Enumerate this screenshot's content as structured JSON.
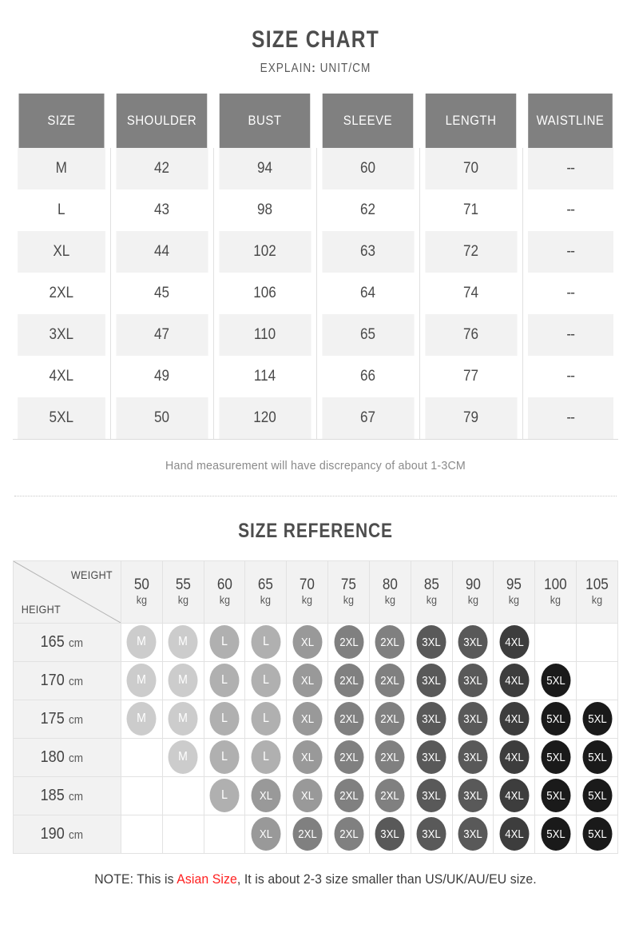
{
  "header": {
    "title": "SIZE CHART",
    "explain_label": "EXPLAIN",
    "explain_colon": ":",
    "explain_value": "UNIT/CM"
  },
  "size_chart": {
    "columns": [
      "SIZE",
      "SHOULDER",
      "BUST",
      "SLEEVE",
      "LENGTH",
      "WAISTLINE"
    ],
    "rows": [
      {
        "size": "M",
        "shoulder": "42",
        "bust": "94",
        "sleeve": "60",
        "length": "70",
        "waistline": "--"
      },
      {
        "size": "L",
        "shoulder": "43",
        "bust": "98",
        "sleeve": "62",
        "length": "71",
        "waistline": "--"
      },
      {
        "size": "XL",
        "shoulder": "44",
        "bust": "102",
        "sleeve": "63",
        "length": "72",
        "waistline": "--"
      },
      {
        "size": "2XL",
        "shoulder": "45",
        "bust": "106",
        "sleeve": "64",
        "length": "74",
        "waistline": "--"
      },
      {
        "size": "3XL",
        "shoulder": "47",
        "bust": "110",
        "sleeve": "65",
        "length": "76",
        "waistline": "--"
      },
      {
        "size": "4XL",
        "shoulder": "49",
        "bust": "114",
        "sleeve": "66",
        "length": "77",
        "waistline": "--"
      },
      {
        "size": "5XL",
        "shoulder": "50",
        "bust": "120",
        "sleeve": "67",
        "length": "79",
        "waistline": "--"
      }
    ],
    "note": "Hand measurement will have discrepancy of about 1-3CM"
  },
  "size_reference": {
    "title": "SIZE REFERENCE",
    "weight_label": "WEIGHT",
    "height_label": "HEIGHT",
    "weight_unit": "kg",
    "height_unit": "cm",
    "weights": [
      "50",
      "55",
      "60",
      "65",
      "70",
      "75",
      "80",
      "85",
      "90",
      "95",
      "100",
      "105"
    ],
    "heights": [
      "165",
      "170",
      "175",
      "180",
      "185",
      "190"
    ],
    "matrix": [
      [
        "M",
        "M",
        "L",
        "L",
        "XL",
        "2XL",
        "2XL",
        "3XL",
        "3XL",
        "4XL",
        "",
        ""
      ],
      [
        "M",
        "M",
        "L",
        "L",
        "XL",
        "2XL",
        "2XL",
        "3XL",
        "3XL",
        "4XL",
        "5XL",
        ""
      ],
      [
        "M",
        "M",
        "L",
        "L",
        "XL",
        "2XL",
        "2XL",
        "3XL",
        "3XL",
        "4XL",
        "5XL",
        "5XL"
      ],
      [
        "",
        "M",
        "L",
        "L",
        "XL",
        "2XL",
        "2XL",
        "3XL",
        "3XL",
        "4XL",
        "5XL",
        "5XL"
      ],
      [
        "",
        "",
        "L",
        "XL",
        "XL",
        "2XL",
        "2XL",
        "3XL",
        "3XL",
        "4XL",
        "5XL",
        "5XL"
      ],
      [
        "",
        "",
        "",
        "XL",
        "2XL",
        "2XL",
        "3XL",
        "3XL",
        "3XL",
        "4XL",
        "5XL",
        "5XL"
      ]
    ]
  },
  "footer": {
    "note_prefix": "NOTE: This is ",
    "note_accent": "Asian Size",
    "note_suffix": ", It is about 2-3 size smaller than US/UK/AU/EU size."
  },
  "colors": {
    "header_bar": "#808080",
    "row_alt": "#f2f2f2",
    "accent_red": "#ff2020",
    "size_M": "#cccccc",
    "size_L": "#b0b0b0",
    "size_XL": "#999999",
    "size_2XL": "#808080",
    "size_3XL": "#595959",
    "size_4XL": "#3d3d3d",
    "size_5XL": "#1a1a1a"
  }
}
